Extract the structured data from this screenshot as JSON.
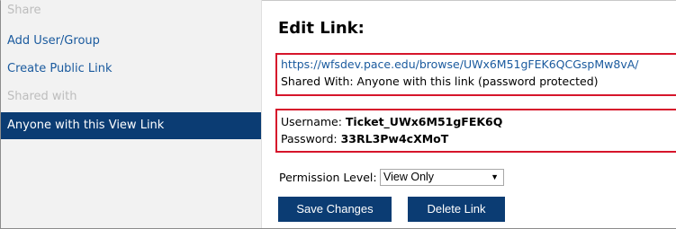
{
  "sidebar": {
    "share_header": "Share",
    "add_user_group": "Add User/Group",
    "create_public_link": "Create Public Link",
    "shared_with_header": "Shared with",
    "active_item": "Anyone with this View Link"
  },
  "edit": {
    "title": "Edit Link:",
    "url": "https://wfsdev.pace.edu/browse/UWx6M51gFEK6QCGspMw8vA/",
    "shared_with": "Shared With: Anyone with this link (password protected)",
    "username_label": "Username: ",
    "username_value": "Ticket_UWx6M51gFEK6Q",
    "password_label": "Password: ",
    "password_value": "33RL3Pw4cXMoT",
    "permission_label": "Permission Level:",
    "permission_value": "View Only",
    "save_button": "Save Changes",
    "delete_button": "Delete Link"
  },
  "colors": {
    "active_bg": "#0b3c73",
    "link": "#1a5a9e",
    "highlight_border": "#d6152b",
    "sidebar_bg": "#f2f2f2"
  }
}
